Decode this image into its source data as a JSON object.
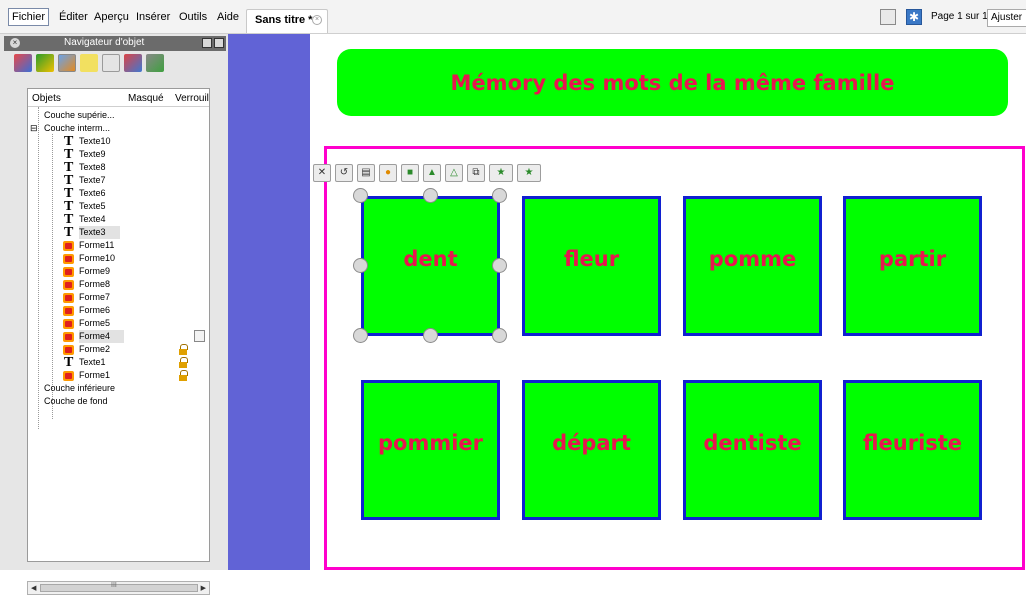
{
  "menu": {
    "items": [
      "Fichier",
      "Éditer",
      "Aperçu",
      "Insérer",
      "Outils",
      "Aide"
    ]
  },
  "tab": {
    "label": "Sans titre *",
    "close_glyph": "×"
  },
  "page_indicator": "Page 1 sur 1",
  "zoom": "Ajuster",
  "navigator": {
    "title": "Navigateur d'objet",
    "columns": [
      "Objets",
      "Masqué",
      "Verrouil"
    ],
    "tree": [
      {
        "label": "Couche supérie...",
        "level": 0,
        "icon": "none"
      },
      {
        "label": "Couche interm...",
        "level": 0,
        "icon": "none",
        "expander": "⊟"
      },
      {
        "label": "Texte10",
        "level": 1,
        "icon": "text-icon"
      },
      {
        "label": "Texte9",
        "level": 1,
        "icon": "text-icon"
      },
      {
        "label": "Texte8",
        "level": 1,
        "icon": "text-icon"
      },
      {
        "label": "Texte7",
        "level": 1,
        "icon": "text-icon"
      },
      {
        "label": "Texte6",
        "level": 1,
        "icon": "text-icon"
      },
      {
        "label": "Texte5",
        "level": 1,
        "icon": "text-icon"
      },
      {
        "label": "Texte4",
        "level": 1,
        "icon": "text-icon"
      },
      {
        "label": "Texte3",
        "level": 1,
        "icon": "text-icon",
        "selected": true
      },
      {
        "label": "Forme11",
        "level": 1,
        "icon": "shape-icon"
      },
      {
        "label": "Forme10",
        "level": 1,
        "icon": "shape-icon"
      },
      {
        "label": "Forme9",
        "level": 1,
        "icon": "shape-icon"
      },
      {
        "label": "Forme8",
        "level": 1,
        "icon": "shape-icon"
      },
      {
        "label": "Forme7",
        "level": 1,
        "icon": "shape-icon"
      },
      {
        "label": "Forme6",
        "level": 1,
        "icon": "shape-icon"
      },
      {
        "label": "Forme5",
        "level": 1,
        "icon": "shape-icon"
      },
      {
        "label": "Forme4",
        "level": 1,
        "icon": "shape-icon",
        "selected": true,
        "menu": true
      },
      {
        "label": "Forme2",
        "level": 1,
        "icon": "shape-icon",
        "locked": true
      },
      {
        "label": "Texte1",
        "level": 1,
        "icon": "text-icon",
        "locked": true
      },
      {
        "label": "Forme1",
        "level": 1,
        "icon": "shape-icon",
        "locked": true
      },
      {
        "label": "Couche inférieure",
        "level": 0,
        "icon": "none"
      },
      {
        "label": "Couche de fond",
        "level": 0,
        "icon": "none"
      }
    ],
    "scroll_glyph": "III"
  },
  "canvas": {
    "title": "Mémory des mots de la même famille",
    "cards": [
      "dent",
      "fleur",
      "pomme",
      "partir",
      "pommier",
      "départ",
      "dentiste",
      "fleuriste"
    ],
    "selected_card": "dent"
  },
  "colors": {
    "accent_green": "#00ff00",
    "word_pink": "#e8154f",
    "frame_magenta": "#ff00cc",
    "card_border": "#1020d0",
    "gutter_blue": "#6163d6"
  }
}
